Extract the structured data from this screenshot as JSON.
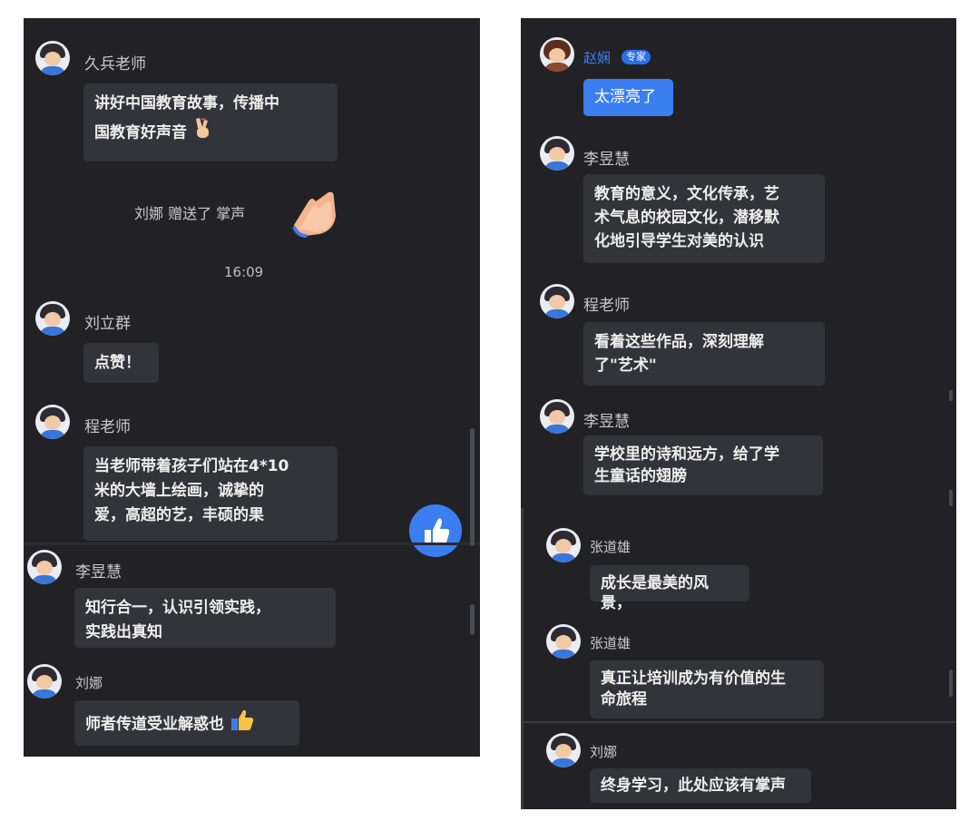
{
  "left_chat": {
    "messages": [
      {
        "name": "久兵老师",
        "text_lines": [
          "讲好中国教育故事，传播中",
          "国教育好声音"
        ]
      },
      {
        "name": "刘立群",
        "text": "点赞！"
      },
      {
        "name": "程老师",
        "text_lines": [
          "当老师带着孩子们站在4*10",
          "米的大墙上绘画，诚挚的",
          "爱，高超的艺，丰硕的果"
        ]
      },
      {
        "name": "李昱慧",
        "text_lines": [
          "知行合一，认识引领实践，",
          "实践出真知"
        ]
      },
      {
        "name": "刘娜",
        "text": "师者传道受业解惑也"
      }
    ],
    "gift_notice": "刘娜 赠送了 掌声",
    "timestamp": "16:09"
  },
  "right_chat": {
    "messages": [
      {
        "name": "赵娴",
        "badge": "专家",
        "text": "太漂亮了"
      },
      {
        "name": "李昱慧",
        "text_lines": [
          "教育的意义，文化传承，艺",
          "术气息的校园文化，潜移默",
          "化地引导学生对美的认识"
        ]
      },
      {
        "name": "程老师",
        "text_lines": [
          "看着这些作品，深刻理解",
          "了\"艺术\""
        ]
      },
      {
        "name": "李昱慧",
        "text_lines": [
          "学校里的诗和远方，给了学",
          "生童话的翅膀"
        ]
      },
      {
        "name": "张道雄",
        "text": "成长是最美的风景，"
      },
      {
        "name": "张道雄",
        "text_lines": [
          "真正让培训成为有价值的生",
          "命旅程"
        ]
      },
      {
        "name": "刘娜",
        "text": "终身学习，此处应该有掌声"
      }
    ]
  },
  "icons": [
    "avatar-icon",
    "victory-hand-icon",
    "clapping-hands-icon",
    "thumbs-up-icon"
  ],
  "colors": {
    "panel_bg": "#222226",
    "bubble_bg": "#33333a",
    "accent_blue": "#3b7ef0"
  }
}
